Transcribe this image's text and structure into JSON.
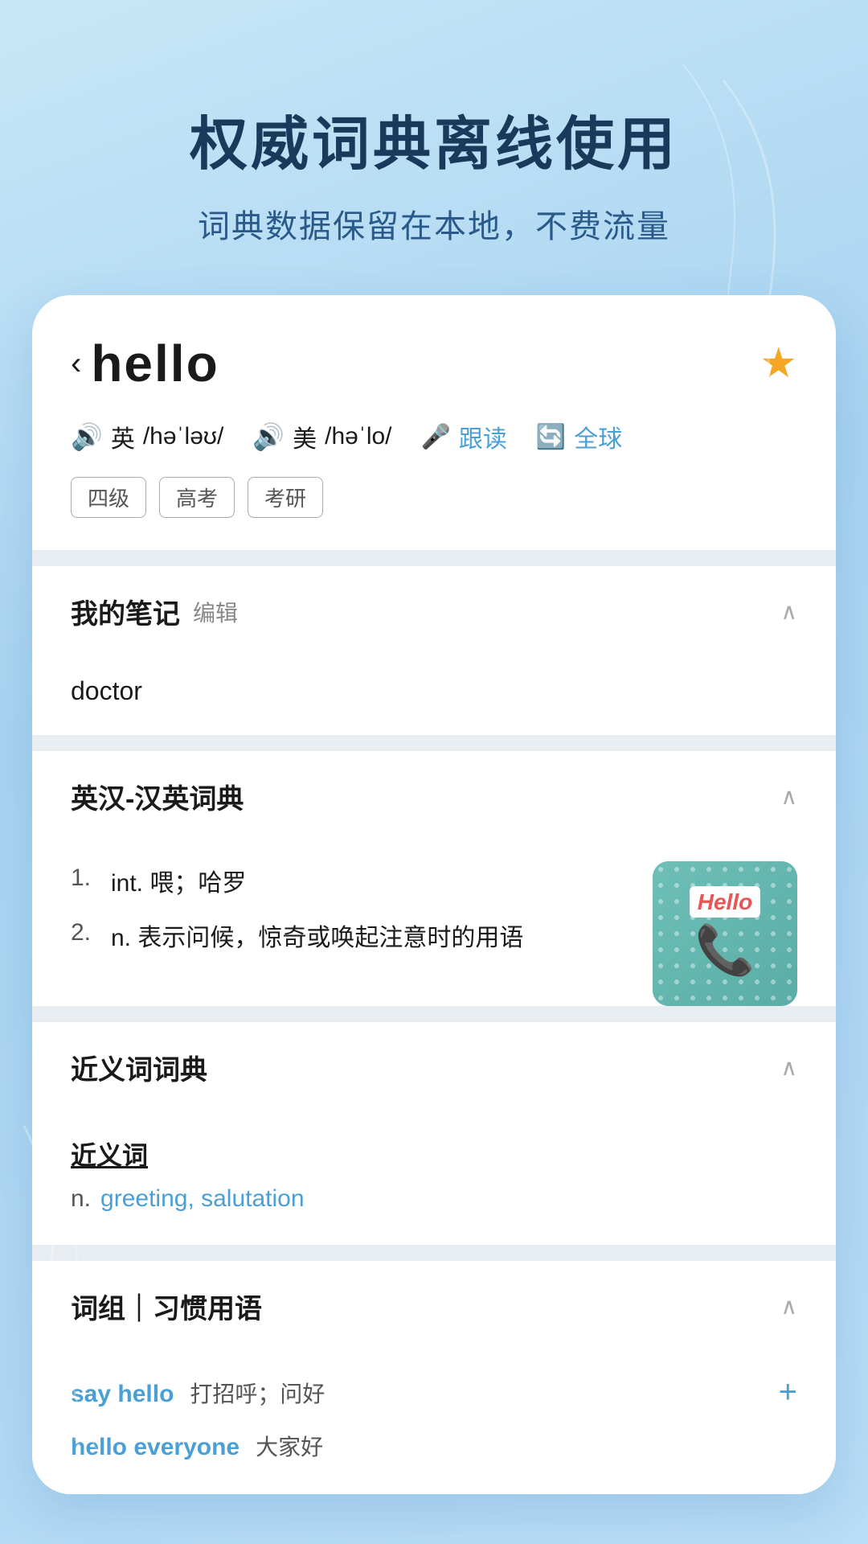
{
  "header": {
    "title": "权威词典离线使用",
    "subtitle": "词典数据保留在本地，不费流量"
  },
  "word": {
    "back_arrow": "‹",
    "word": "hello",
    "star_icon": "★",
    "pronunciations": {
      "british": {
        "label": "英",
        "ipa": "/həˈləʊ/"
      },
      "american": {
        "label": "美",
        "ipa": "/həˈlo/"
      },
      "follow_read": "跟读",
      "global": "全球"
    },
    "tags": [
      "四级",
      "高考",
      "考研"
    ]
  },
  "sections": {
    "notes": {
      "title": "我的笔记",
      "edit_label": "编辑",
      "content": "doctor"
    },
    "english_chinese": {
      "title": "英汉-汉英词典",
      "entries": [
        {
          "num": "1.",
          "text": "int. 喂；哈罗"
        },
        {
          "num": "2.",
          "text": "n. 表示问候，惊奇或唤起注意时的用语"
        }
      ],
      "image_alt": "Hello telephone illustration"
    },
    "synonyms": {
      "title": "近义词词典",
      "synonym_header": "近义词",
      "pos": "n.",
      "words": "greeting, salutation"
    },
    "phrases": {
      "title": "词组｜习惯用语",
      "items": [
        {
          "en": "say hello",
          "zh": "打招呼；问好",
          "has_add": true
        },
        {
          "en": "hello everyone",
          "zh": "大家好",
          "has_add": false
        }
      ]
    }
  }
}
